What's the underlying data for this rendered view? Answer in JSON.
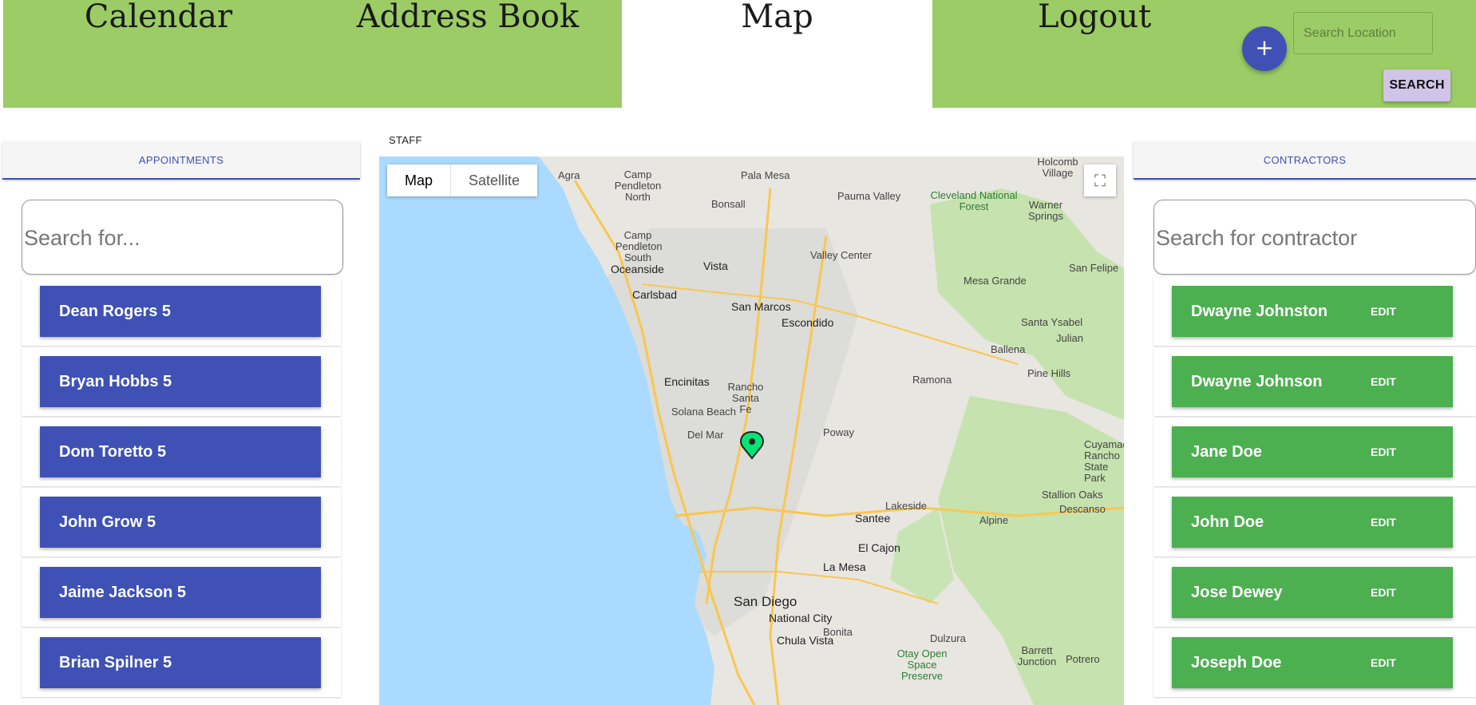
{
  "nav": {
    "calendar": "Calendar",
    "address_book": "Address Book",
    "map": "Map",
    "logout": "Logout"
  },
  "fab_label": "+",
  "search_location": {
    "placeholder": "Search Location",
    "button": "SEARCH"
  },
  "left": {
    "header": "APPOINTMENTS",
    "search_placeholder": "Search for...",
    "items": [
      "Dean Rogers 5",
      "Bryan Hobbs 5",
      "Dom Toretto 5",
      "John Grow 5",
      "Jaime Jackson 5",
      "Brian Spilner 5"
    ]
  },
  "center": {
    "label": "STAFF",
    "map_types": [
      "Map",
      "Satellite"
    ],
    "places": {
      "agra": "Agra",
      "camp_pendleton_north": "Camp Pendleton North",
      "pala_mesa": "Pala Mesa",
      "pauma_valley": "Pauma Valley",
      "cleveland": "Cleveland National Forest",
      "warner_springs": "Warner Springs",
      "holcomb": "Holcomb Village",
      "bonsall": "Bonsall",
      "camp_pendleton_south": "Camp Pendleton South",
      "valley_center": "Valley Center",
      "oceanside": "Oceanside",
      "vista": "Vista",
      "san_felipe": "San Felipe",
      "mesa_grande": "Mesa Grande",
      "carlsbad": "Carlsbad",
      "san_marcos": "San Marcos",
      "escondido": "Escondido",
      "santa_ysabel": "Santa Ysabel",
      "julian": "Julian",
      "ballena": "Ballena",
      "encinitas": "Encinitas",
      "rancho_santa_fe": "Rancho Santa Fe",
      "ramona": "Ramona",
      "pine_hills": "Pine Hills",
      "solana_beach": "Solana Beach",
      "del_mar": "Del Mar",
      "poway": "Poway",
      "cuyamaca": "Cuyamaca Rancho State Park",
      "stallion_oaks": "Stallion Oaks",
      "lakeside": "Lakeside",
      "descanso": "Descanso",
      "santee": "Santee",
      "alpine": "Alpine",
      "el_cajon": "El Cajon",
      "la_mesa": "La Mesa",
      "san_diego": "San Diego",
      "national_city": "National City",
      "bonita": "Bonita",
      "dulzura": "Dulzura",
      "chula_vista": "Chula Vista",
      "otay": "Otay Open Space Preserve",
      "barrett": "Barrett Junction",
      "potrero": "Potrero"
    }
  },
  "right": {
    "header": "CONTRACTORS",
    "search_placeholder": "Search for contractor",
    "edit_label": "EDIT",
    "items": [
      "Dwayne Johnston",
      "Dwayne Johnson",
      "Jane Doe",
      "John Doe",
      "Jose Dewey",
      "Joseph Doe"
    ]
  },
  "colors": {
    "nav_green": "#9ccc65",
    "primary_blue": "#3f51b5",
    "contractor_green": "#4caf50",
    "search_button": "#d1c4e9",
    "ocean": "#aadaff",
    "marker": "#00e676"
  },
  "icons": {
    "fab": "plus-icon",
    "fullscreen": "fullscreen-icon",
    "marker": "map-pin-icon"
  }
}
